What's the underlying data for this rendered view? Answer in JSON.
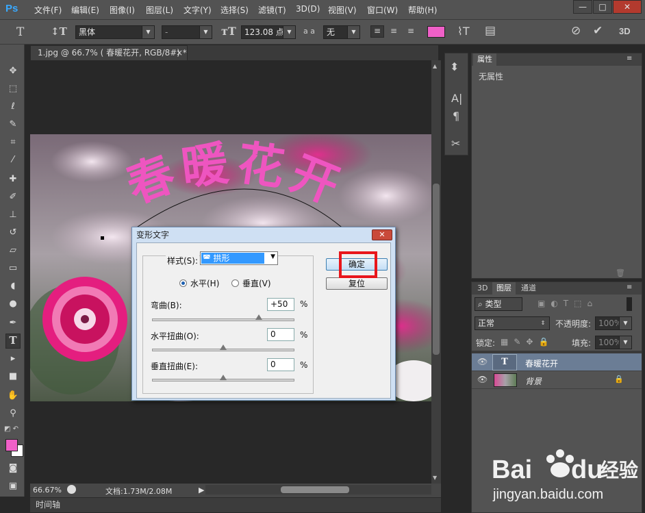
{
  "app": {
    "logo": "Ps"
  },
  "menu": [
    "文件(F)",
    "编辑(E)",
    "图像(I)",
    "图层(L)",
    "文字(Y)",
    "选择(S)",
    "滤镜(T)",
    "3D(D)",
    "视图(V)",
    "窗口(W)",
    "帮助(H)"
  ],
  "window_controls": {
    "minimize": "—",
    "restore": "□",
    "close": "✕"
  },
  "options": {
    "font_family": "黑体",
    "font_style": "-",
    "font_size": "123.08 点",
    "antialias_icon": "a a",
    "antialias": "无",
    "text_color": "#f060c8",
    "mode_3d": "3D"
  },
  "document": {
    "tab_title": "1.jpg @ 66.7% ( 春暖花开, RGB/8#) *",
    "tab_close": "×",
    "warped_text": "春暖花开",
    "text_color": "#ee55c0",
    "zoom": "66.67%",
    "doc_info": "文档:1.73M/2.08M"
  },
  "timeline": {
    "label": "时间轴"
  },
  "dialog": {
    "title": "变形文字",
    "close": "✕",
    "style_label": "样式(S):",
    "style_value": "拱形",
    "orient_horizontal": "水平(H)",
    "orient_vertical": "垂直(V)",
    "orientation_selected": "horizontal",
    "bend_label": "弯曲(B):",
    "bend_value": "+50",
    "bend_pct": "%",
    "bend_level": 0.75,
    "hdist_label": "水平扭曲(O):",
    "hdist_value": "0",
    "hdist_pct": "%",
    "hdist_level": 0.5,
    "vdist_label": "垂直扭曲(E):",
    "vdist_value": "0",
    "vdist_pct": "%",
    "vdist_level": 0.5,
    "ok_label": "确定",
    "reset_label": "复位",
    "highlight_color": "#e8161b"
  },
  "props_panel": {
    "tab": "属性",
    "content": "无属性"
  },
  "layers_panel": {
    "tabs": [
      "3D",
      "图层",
      "通道"
    ],
    "active_tab": "图层",
    "filter": "类型",
    "blend_mode": "正常",
    "opacity_label": "不透明度:",
    "opacity_value": "100%",
    "lock_label": "锁定:",
    "fill_label": "填充:",
    "fill_value": "100%",
    "layers": [
      {
        "name": "春暖花开",
        "thumb": "T",
        "selected": true,
        "locked": false
      },
      {
        "name": "背景",
        "thumb": "",
        "selected": false,
        "locked": true
      }
    ]
  },
  "watermark": {
    "brand": "Bai",
    "brand2": "du",
    "cn": "经验",
    "url": "jingyan.baidu.com"
  }
}
